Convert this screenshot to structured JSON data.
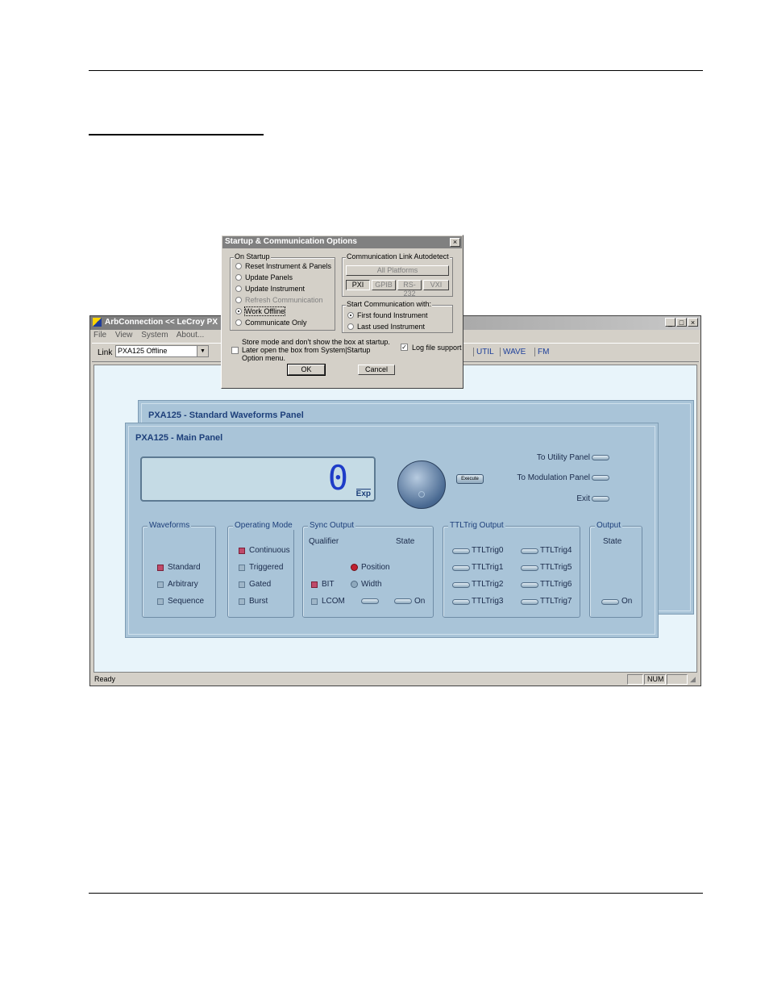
{
  "app": {
    "title": "ArbConnection   << LeCroy PX",
    "menu": [
      "File",
      "View",
      "System",
      "About..."
    ],
    "link_label": "Link",
    "link_value": "PXA125 Offline",
    "tabs": [
      "UTIL",
      "WAVE",
      "FM"
    ],
    "status": {
      "ready": "Ready",
      "num": "NUM"
    }
  },
  "dialog": {
    "title": "Startup & Communication Options",
    "on_startup": {
      "label": "On Startup",
      "options": [
        {
          "label": "Reset Instrument & Panels"
        },
        {
          "label": "Update Panels"
        },
        {
          "label": "Update Instrument"
        },
        {
          "label": "Refresh Communication"
        },
        {
          "label": "Work Offline"
        },
        {
          "label": "Communicate Only"
        }
      ],
      "selected": "Work Offline"
    },
    "autodetect": {
      "label": "Communication Link Autodetect",
      "all_platforms": "All Platforms",
      "buttons": [
        "PXI",
        "GPIB",
        "RS-232",
        "VXI"
      ]
    },
    "start_comm": {
      "label": "Start Communication with:",
      "options": [
        "First found Instrument",
        "Last used Instrument"
      ],
      "selected": "First found Instrument"
    },
    "store_mode_text": "Store mode and don't show the box at startup. Later open the box from System|Startup Option menu.",
    "log_file": "Log file support",
    "ok": "OK",
    "cancel": "Cancel"
  },
  "waveforms_panel": {
    "title": "PXA125 - Standard Waveforms Panel"
  },
  "main_panel": {
    "title": "PXA125 - Main Panel",
    "display_value": "0",
    "exp": "Exp",
    "execute": "Execute",
    "links": [
      "To Utility Panel",
      "To Modulation Panel",
      "Exit"
    ],
    "waveforms": {
      "label": "Waveforms",
      "items": [
        "Standard",
        "Arbitrary",
        "Sequence"
      ]
    },
    "operating_mode": {
      "label": "Operating Mode",
      "items": [
        "Continuous",
        "Triggered",
        "Gated",
        "Burst"
      ]
    },
    "sync_output": {
      "label": "Sync Output",
      "qualifier": "Qualifier",
      "state": "State",
      "position": "Position",
      "width": "Width",
      "bit": "BIT",
      "lcom": "LCOM",
      "on": "On"
    },
    "ttltrig": {
      "label": "TTLTrig Output",
      "items": [
        "TTLTrig0",
        "TTLTrig1",
        "TTLTrig2",
        "TTLTrig3",
        "TTLTrig4",
        "TTLTrig5",
        "TTLTrig6",
        "TTLTrig7"
      ]
    },
    "output": {
      "label": "Output",
      "state": "State",
      "on": "On"
    }
  }
}
